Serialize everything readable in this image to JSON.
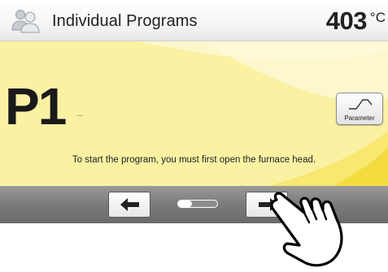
{
  "header": {
    "title": "Individual Programs",
    "temperature": "403",
    "unit": "°C",
    "icon": "users-icon"
  },
  "program": {
    "code": "P1",
    "name": "..."
  },
  "parameter_button": {
    "label": "Parameter",
    "icon": "firing-curve-icon"
  },
  "status_message": "To start the program, you must first open the furnace head.",
  "navigation": {
    "back_icon": "arrow-left-icon",
    "forward_icon": "arrow-right-icon",
    "page_position": 0.35
  },
  "pointer_icon": "hand-pointer-icon",
  "colors": {
    "main_background": "#fbf1a3",
    "bottom_bar": "#7b7b7b",
    "header_background": "#f3f3f3"
  }
}
